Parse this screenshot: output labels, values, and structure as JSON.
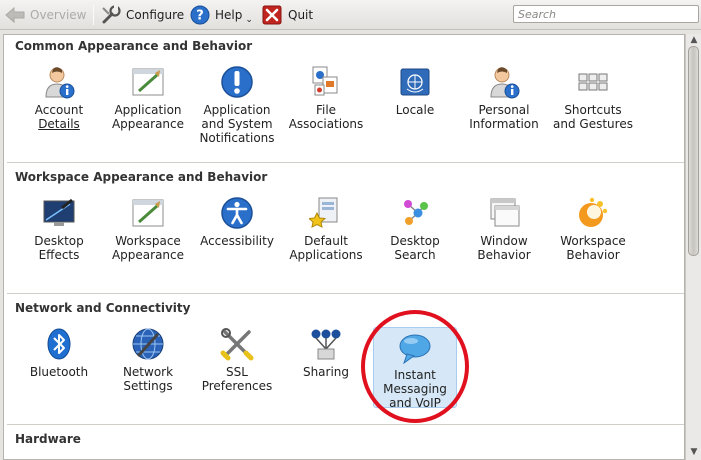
{
  "toolbar": {
    "overview": "Overview",
    "configure": "Configure",
    "help": "Help",
    "quit": "Quit",
    "search_placeholder": "Search"
  },
  "categories": [
    {
      "title": "Common Appearance and Behavior",
      "items": [
        {
          "line1": "Account",
          "line2": "Details",
          "icon": "user-info-icon"
        },
        {
          "line1": "Application",
          "line2": "Appearance",
          "icon": "appearance-icon"
        },
        {
          "line1": "Application",
          "line2": "and System",
          "line3": "Notifications",
          "icon": "exclamation-icon"
        },
        {
          "line1": "File",
          "line2": "Associations",
          "icon": "file-associations-icon"
        },
        {
          "line1": "Locale",
          "icon": "flag-icon"
        },
        {
          "line1": "Personal",
          "line2": "Information",
          "icon": "user-info-icon"
        },
        {
          "line1": "Shortcuts",
          "line2": "and Gestures",
          "icon": "keyboard-icon"
        }
      ]
    },
    {
      "title": "Workspace Appearance and Behavior",
      "items": [
        {
          "line1": "Desktop",
          "line2": "Effects",
          "icon": "desktop-effects-icon"
        },
        {
          "line1": "Workspace",
          "line2": "Appearance",
          "icon": "appearance-icon"
        },
        {
          "line1": "Accessibility",
          "icon": "accessibility-icon"
        },
        {
          "line1": "Default",
          "line2": "Applications",
          "icon": "default-apps-icon"
        },
        {
          "line1": "Desktop",
          "line2": "Search",
          "icon": "desktop-search-icon"
        },
        {
          "line1": "Window",
          "line2": "Behavior",
          "icon": "window-icon"
        },
        {
          "line1": "Workspace",
          "line2": "Behavior",
          "icon": "workspace-behavior-icon"
        }
      ]
    },
    {
      "title": "Network and Connectivity",
      "items": [
        {
          "line1": "Bluetooth",
          "icon": "bluetooth-icon"
        },
        {
          "line1": "Network",
          "line2": "Settings",
          "icon": "network-globe-icon"
        },
        {
          "line1": "SSL",
          "line2": "Preferences",
          "icon": "tools-icon"
        },
        {
          "line1": "Sharing",
          "icon": "sharing-icon"
        },
        {
          "line1": "Instant",
          "line2": "Messaging",
          "line3": "and VoIP",
          "icon": "speech-bubble-icon"
        }
      ]
    },
    {
      "title": "Hardware",
      "items": []
    }
  ],
  "colors": {
    "accent_blue": "#2a6fc9",
    "selection": "#d6e8f7",
    "highlight_circle": "#e0101e",
    "quit_red": "#c0261f"
  }
}
